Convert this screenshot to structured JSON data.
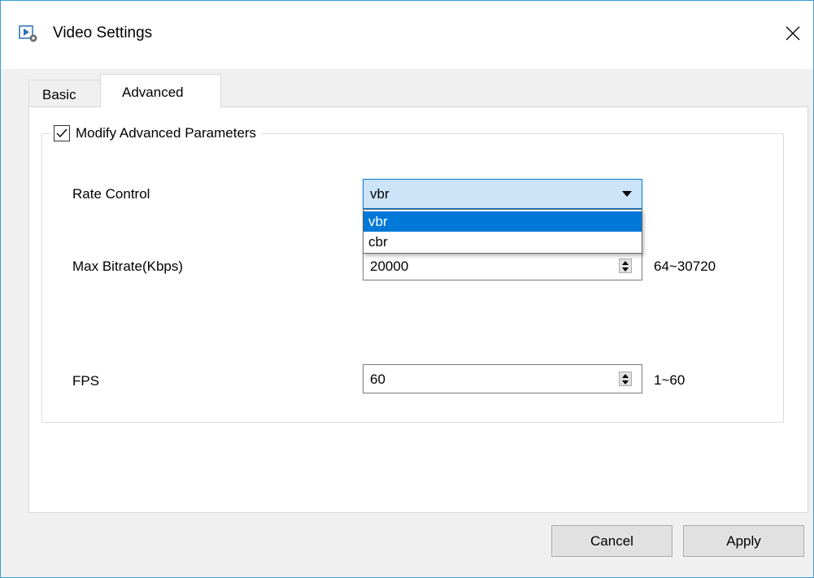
{
  "window": {
    "title": "Video Settings",
    "close_icon": "close-icon",
    "app_icon": "video-settings-icon"
  },
  "tabs": [
    {
      "label": "Basic",
      "active": false
    },
    {
      "label": "Advanced",
      "active": true
    }
  ],
  "group": {
    "label": "Modify Advanced Parameters",
    "checked": true
  },
  "rate_control": {
    "label": "Rate Control",
    "value": "vbr",
    "options": [
      "vbr",
      "cbr"
    ],
    "highlighted": "vbr"
  },
  "max_bitrate": {
    "label": "Max Bitrate(Kbps)",
    "value": "20000",
    "range": "64~30720"
  },
  "fps": {
    "label": "FPS",
    "value": "60",
    "range": "1~60"
  },
  "buttons": {
    "cancel": "Cancel",
    "apply": "Apply"
  },
  "colors": {
    "accent": "#0078d7",
    "selection_bg": "#cce4f7",
    "window_border": "#3c9ad6"
  }
}
